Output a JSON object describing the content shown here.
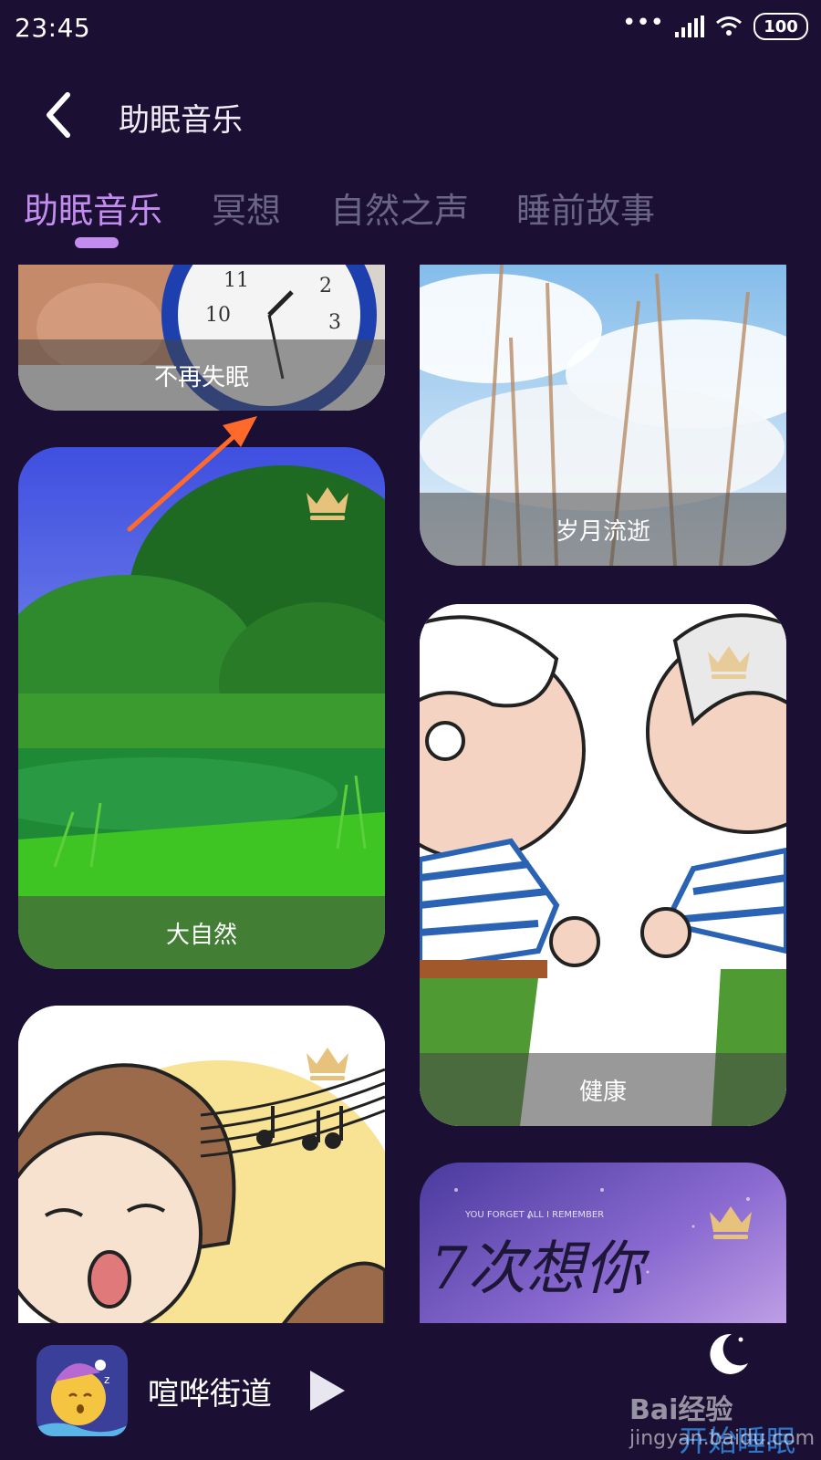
{
  "status": {
    "time": "23:45",
    "battery": "100"
  },
  "header": {
    "title": "助眠音乐"
  },
  "tabs": [
    {
      "label": "助眠音乐",
      "active": true
    },
    {
      "label": "冥想",
      "active": false
    },
    {
      "label": "自然之声",
      "active": false
    },
    {
      "label": "睡前故事",
      "active": false
    }
  ],
  "cards": [
    {
      "title": "不再失眠",
      "premium": false
    },
    {
      "title": "岁月流逝",
      "premium": false
    },
    {
      "title": "大自然",
      "premium": true
    },
    {
      "title": "健康",
      "premium": true
    },
    {
      "title": "",
      "premium": true
    },
    {
      "title": "",
      "premium": true
    }
  ],
  "card_art": {
    "text": "7次想你",
    "small": "YOU FORGET ALL I REMEMBER"
  },
  "player": {
    "track": "喧哗街道",
    "start_label": "开始睡眠"
  },
  "watermark": {
    "brand": "Bai经验",
    "url": "jingyan.baidu.com"
  },
  "colors": {
    "background": "#1b1033",
    "accent": "#c38df0",
    "inactive_tab": "#6a6584",
    "start_button": "#2f76c9"
  },
  "icons": [
    "back-chevron-icon",
    "signal-icon",
    "wifi-icon",
    "battery-icon",
    "crown-icon",
    "play-icon",
    "moon-icon"
  ]
}
